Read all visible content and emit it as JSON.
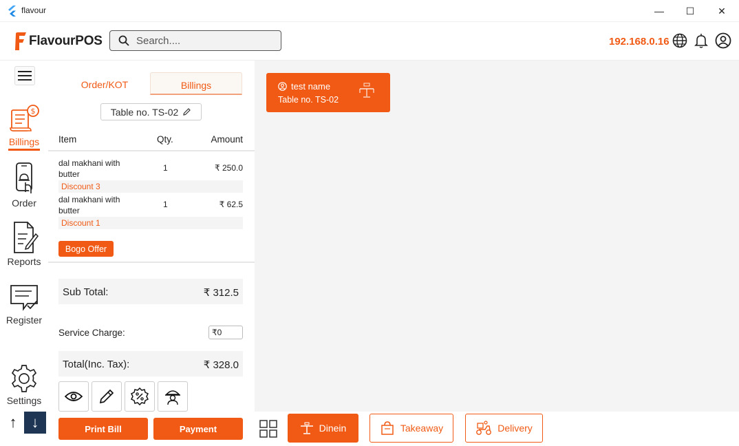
{
  "window": {
    "title": "flavour",
    "min": "—",
    "max": "☐",
    "close": "✕"
  },
  "header": {
    "logo_text": "FlavourPOS",
    "search_placeholder": "Search....",
    "ip": "192.168.0.16"
  },
  "nav": {
    "items": [
      {
        "label": "Billings",
        "icon": "billing-icon",
        "active": true
      },
      {
        "label": "Order",
        "icon": "phone-order-icon"
      },
      {
        "label": "Reports",
        "icon": "report-icon"
      },
      {
        "label": "Register",
        "icon": "register-icon"
      },
      {
        "label": "Settings",
        "icon": "gear-icon"
      }
    ],
    "up": "↑",
    "down": "↓"
  },
  "billing": {
    "tabs": [
      "Order/KOT",
      "Billings"
    ],
    "active_tab": "Billings",
    "table_label": "Table no. TS-02",
    "columns": {
      "item": "Item",
      "qty": "Qty.",
      "amount": "Amount"
    },
    "items": [
      {
        "name": "dal makhani with butter",
        "qty": "1",
        "amount": "₹ 250.0",
        "discount": "Discount 3"
      },
      {
        "name": "dal makhani with butter",
        "qty": "1",
        "amount": "₹ 62.5",
        "discount": "Discount 1"
      }
    ],
    "offer_button": "Bogo Offer",
    "sub_total_label": "Sub Total:",
    "sub_total_value": "₹ 312.5",
    "service_charge_label": "Service Charge:",
    "service_charge_value": "₹0",
    "total_label": "Total(Inc. Tax):",
    "total_value": "₹ 328.0",
    "icon_buttons": [
      "eye-icon",
      "pencil-icon",
      "percent-badge-icon",
      "waiter-icon"
    ],
    "print_button": "Print Bill",
    "payment_button": "Payment"
  },
  "main": {
    "table_card": {
      "name": "test  name",
      "table": "Table no. TS-02"
    }
  },
  "bottom": {
    "modes": [
      {
        "label": "Dinein",
        "active": true
      },
      {
        "label": "Takeaway"
      },
      {
        "label": "Delivery"
      }
    ]
  },
  "colors": {
    "accent": "#f05a14",
    "navy": "#1f3554",
    "panel_bg": "#f4f4f4"
  }
}
